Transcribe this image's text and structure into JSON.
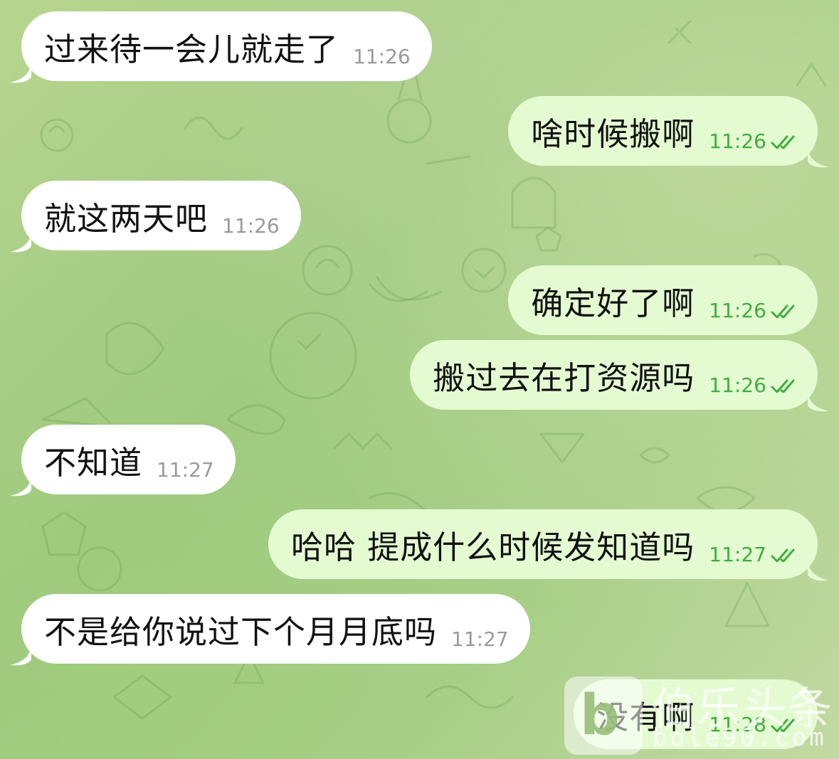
{
  "chat": {
    "messages": [
      {
        "direction": "incoming",
        "text": "过来待一会儿就走了",
        "time": "11:26"
      },
      {
        "direction": "outgoing",
        "text": "啥时候搬啊",
        "time": "11:26",
        "read": true
      },
      {
        "direction": "incoming",
        "text": "就这两天吧",
        "time": "11:26"
      },
      {
        "direction": "outgoing",
        "text": "确定好了啊",
        "time": "11:26",
        "read": true
      },
      {
        "direction": "outgoing",
        "text": "搬过去在打资源吗",
        "time": "11:26",
        "read": true
      },
      {
        "direction": "incoming",
        "text": "不知道",
        "time": "11:27"
      },
      {
        "direction": "outgoing",
        "text": "哈哈 提成什么时候发知道吗",
        "time": "11:27",
        "read": true
      },
      {
        "direction": "incoming",
        "text": "不是给你说过下个月月底吗",
        "time": "11:27"
      },
      {
        "direction": "outgoing",
        "text": "没有啊",
        "time": "11:28",
        "read": true
      }
    ]
  },
  "watermark": {
    "logo_glyph": "b",
    "name": "伯乐头条",
    "url": "bole90.com"
  },
  "colors": {
    "incoming_bubble": "#ffffff",
    "outgoing_bubble": "#e4fbd2",
    "outgoing_time": "#3fae3b",
    "incoming_time": "#9a9a9a",
    "background": "#a9cf8a"
  }
}
